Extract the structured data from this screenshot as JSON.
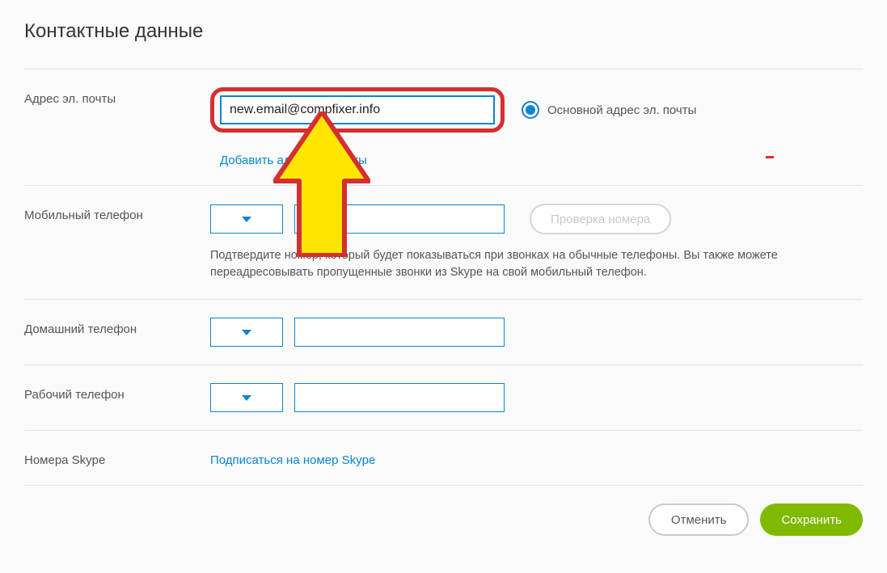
{
  "page": {
    "title": "Контактные данные"
  },
  "email": {
    "label": "Адрес эл. почты",
    "value": "new.email@compfixer.info",
    "primary_label": "Основной адрес эл. почты",
    "add_link": "Добавить адрес эл. почты"
  },
  "mobile": {
    "label": "Мобильный телефон",
    "verify": "Проверка номера",
    "hint": "Подтвердите номер, который будет показываться при звонках на обычные телефоны. Вы также можете переадресовывать пропущенные звонки из Skype на свой мобильный телефон."
  },
  "home": {
    "label": "Домашний телефон"
  },
  "work": {
    "label": "Рабочий телефон"
  },
  "skype": {
    "label": "Номера Skype",
    "link": "Подписаться на номер Skype"
  },
  "buttons": {
    "cancel": "Отменить",
    "save": "Сохранить"
  }
}
